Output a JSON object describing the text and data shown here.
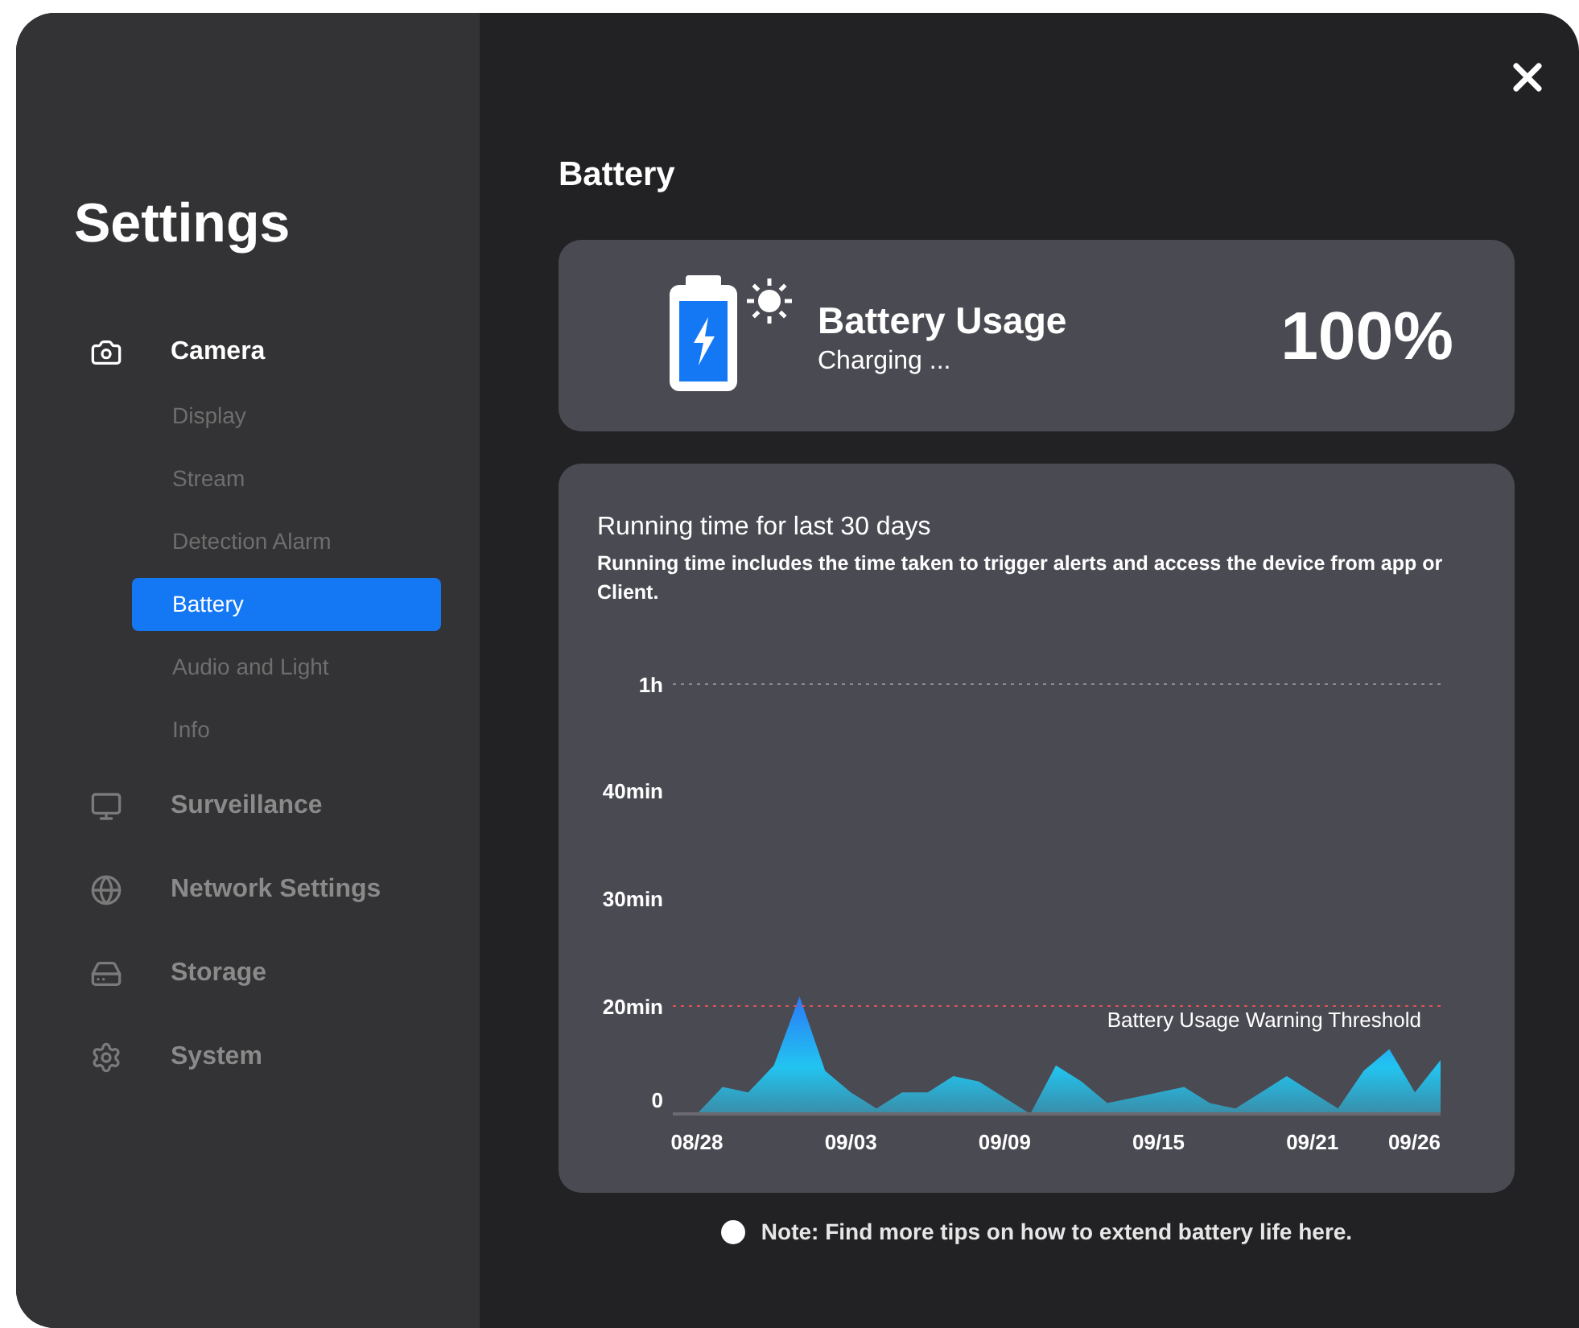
{
  "sidebar": {
    "title": "Settings",
    "items": [
      {
        "label": "Camera",
        "expanded": true,
        "children": [
          {
            "label": "Display",
            "selected": false
          },
          {
            "label": "Stream",
            "selected": false
          },
          {
            "label": "Detection Alarm",
            "selected": false
          },
          {
            "label": "Battery",
            "selected": true
          },
          {
            "label": "Audio and Light",
            "selected": false
          },
          {
            "label": "Info",
            "selected": false
          }
        ]
      },
      {
        "label": "Surveillance",
        "expanded": false
      },
      {
        "label": "Network Settings",
        "expanded": false
      },
      {
        "label": "Storage",
        "expanded": false
      },
      {
        "label": "System",
        "expanded": false
      }
    ]
  },
  "main": {
    "heading": "Battery",
    "usage_card": {
      "title": "Battery Usage",
      "status": "Charging ...",
      "percent": "100%",
      "charging": true
    },
    "chart_card": {
      "title": "Running time for last 30 days",
      "description": "Running time includes the time taken to trigger alerts and access the device from app or Client.",
      "chart": {
        "y_labels": [
          "1h",
          "40min",
          "30min",
          "20min",
          "0"
        ],
        "x_labels": [
          "08/28",
          "09/03",
          "09/09",
          "09/15",
          "09/21",
          "09/26"
        ],
        "threshold_label": "Battery Usage Warning Threshold"
      }
    },
    "note": "Note: Find more tips on how to extend battery life here."
  }
}
